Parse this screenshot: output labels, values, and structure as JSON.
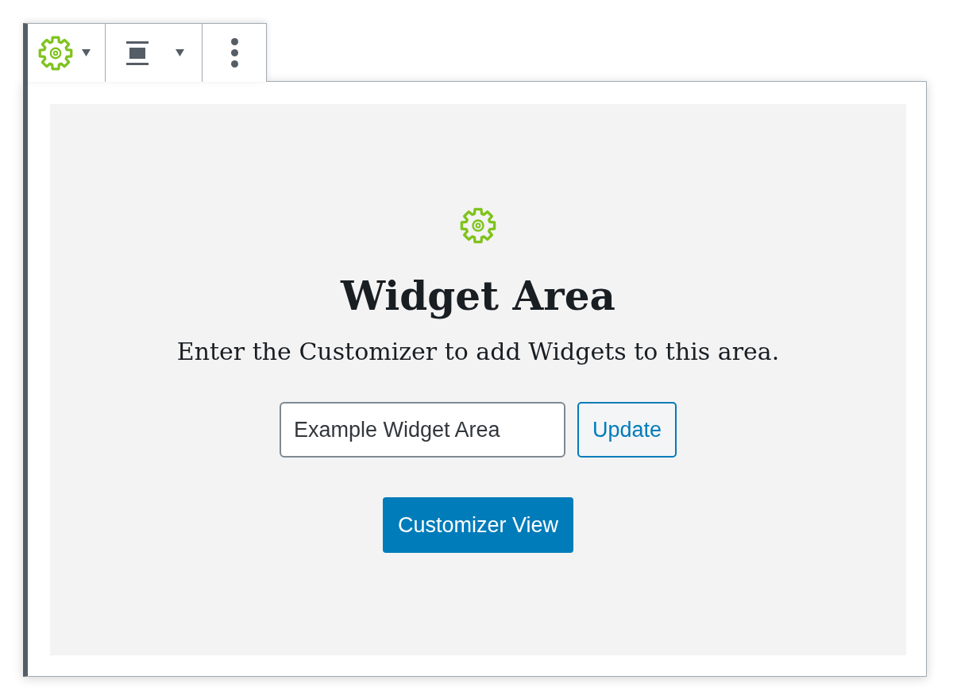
{
  "block": {
    "title": "Widget Area",
    "description": "Enter the Customizer to add Widgets to this area.",
    "name_field": {
      "value": "Example Widget Area"
    },
    "buttons": [
      {
        "kind": "secondary",
        "label": "Update"
      },
      {
        "kind": "primary",
        "label": "Customizer View"
      }
    ]
  }
}
